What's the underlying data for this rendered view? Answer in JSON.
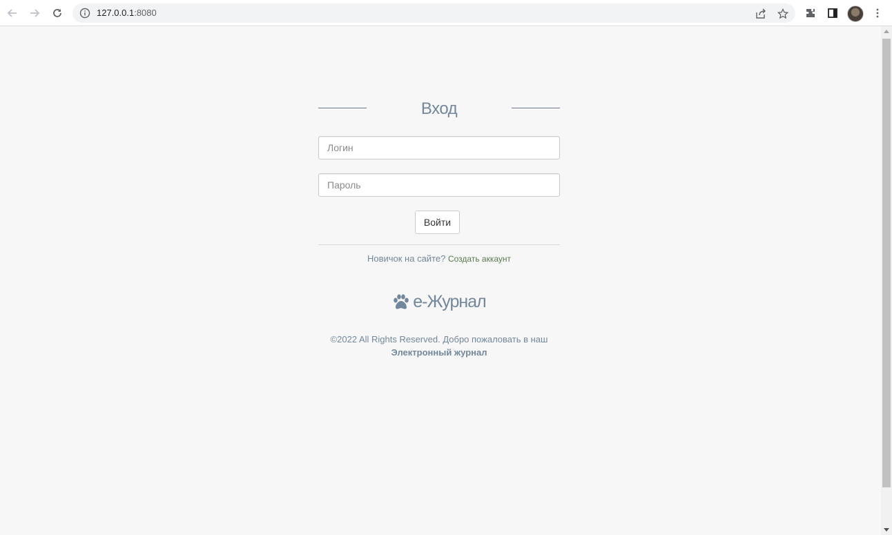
{
  "browser": {
    "url_host": "127.0.0.1",
    "url_port": ":8080"
  },
  "login": {
    "title": "Вход",
    "username_placeholder": "Логин",
    "password_placeholder": "Пароль",
    "submit_label": "Войти",
    "newbie_text": "Новичок на сайте?",
    "create_account_link": "Создать аккаунт"
  },
  "brand": {
    "name": "e-Журнал",
    "icon": "paw-icon"
  },
  "footer": {
    "copyright": "©2022 All Rights Reserved. Добро пожаловать в наш",
    "site_name": "Электронный журнал"
  },
  "colors": {
    "text_muted": "#73879c",
    "link_green": "#5a7a4f",
    "page_bg": "#f7f7f7"
  }
}
